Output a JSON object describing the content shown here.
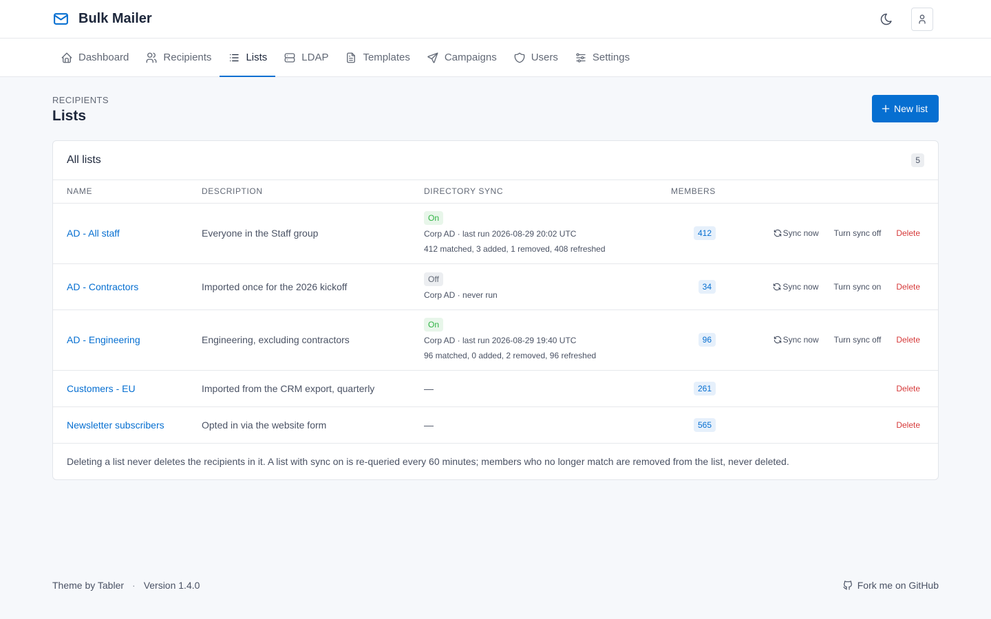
{
  "app": {
    "title": "Bulk Mailer",
    "accent_color": "#066fd1"
  },
  "nav": {
    "items": [
      {
        "label": "Dashboard",
        "icon": "home-icon"
      },
      {
        "label": "Recipients",
        "icon": "users-icon"
      },
      {
        "label": "Lists",
        "icon": "list-icon",
        "active": true
      },
      {
        "label": "LDAP",
        "icon": "server-icon"
      },
      {
        "label": "Templates",
        "icon": "file-text-icon"
      },
      {
        "label": "Campaigns",
        "icon": "send-icon"
      },
      {
        "label": "Users",
        "icon": "shield-icon"
      },
      {
        "label": "Settings",
        "icon": "adjustments-icon"
      }
    ]
  },
  "page": {
    "pretitle": "Recipients",
    "title": "Lists",
    "new_button": "New list"
  },
  "card": {
    "title": "All lists",
    "count": "5",
    "columns": {
      "name": "Name",
      "description": "Description",
      "sync": "Directory sync",
      "members": "Members"
    },
    "rows": [
      {
        "name": "AD - All staff",
        "description": "Everyone in the Staff group",
        "sync_status": "On",
        "sync_source": "Corp AD · last run 2026-08-29 20:02 UTC",
        "sync_stats": "412 matched, 3 added, 1 removed, 408 refreshed",
        "members": "412",
        "sync_now": "Sync now",
        "toggle": "Turn sync off",
        "delete": "Delete"
      },
      {
        "name": "AD - Contractors",
        "description": "Imported once for the 2026 kickoff",
        "sync_status": "Off",
        "sync_source": "Corp AD · never run",
        "sync_stats": "",
        "members": "34",
        "sync_now": "Sync now",
        "toggle": "Turn sync on",
        "delete": "Delete"
      },
      {
        "name": "AD - Engineering",
        "description": "Engineering, excluding contractors",
        "sync_status": "On",
        "sync_source": "Corp AD · last run 2026-08-29 19:40 UTC",
        "sync_stats": "96 matched, 0 added, 2 removed, 96 refreshed",
        "members": "96",
        "sync_now": "Sync now",
        "toggle": "Turn sync off",
        "delete": "Delete"
      },
      {
        "name": "Customers - EU",
        "description": "Imported from the CRM export, quarterly",
        "sync_placeholder": "—",
        "members": "261",
        "delete": "Delete"
      },
      {
        "name": "Newsletter subscribers",
        "description": "Opted in via the website form",
        "sync_placeholder": "—",
        "members": "565",
        "delete": "Delete"
      }
    ],
    "footer_note": "Deleting a list never deletes the recipients in it. A list with sync on is re-queried every 60 minutes; members who no longer match are removed from the list, never deleted."
  },
  "footer": {
    "theme_credit": "Theme by Tabler",
    "separator": "·",
    "version": "Version 1.4.0",
    "github": "Fork me on GitHub"
  }
}
